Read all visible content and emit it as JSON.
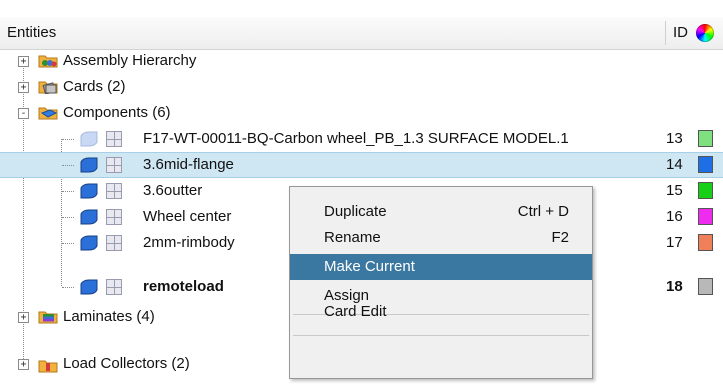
{
  "header": {
    "entities_label": "Entities",
    "id_label": "ID",
    "color_icon": "color-wheel-icon"
  },
  "tree": {
    "assembly": {
      "label": "Assembly Hierarchy",
      "expander": "+"
    },
    "cards": {
      "label": "Cards (2)",
      "expander": "+"
    },
    "components": {
      "label": "Components (6)",
      "expander": "-"
    },
    "laminates": {
      "label": "Laminates (4)",
      "expander": "+"
    },
    "load_collectors": {
      "label": "Load Collectors (2)",
      "expander": "+"
    }
  },
  "components": [
    {
      "label": "F17-WT-00011-BQ-Carbon wheel_PB_1.3 SURFACE MODEL.1",
      "id": "13",
      "color": "#7ee07e",
      "bold": false
    },
    {
      "label": "3.6mid-flange",
      "id": "14",
      "color": "#1e6fe6",
      "bold": false,
      "selected": true
    },
    {
      "label": "3.6outter",
      "id": "15",
      "color": "#16d016",
      "bold": false
    },
    {
      "label": "Wheel center",
      "id": "16",
      "color": "#ee2bee",
      "bold": false
    },
    {
      "label": "2mm-rimbody",
      "id": "17",
      "color": "#f0805a",
      "bold": false
    },
    {
      "label": "remoteload",
      "id": "18",
      "color": "#b8b8b8",
      "bold": true
    }
  ],
  "context_menu": {
    "duplicate": {
      "label": "Duplicate",
      "shortcut": "Ctrl + D"
    },
    "rename": {
      "label": "Rename",
      "shortcut": "F2"
    },
    "make_current": {
      "label": "Make Current"
    },
    "assign": {
      "label": "Assign"
    },
    "card_edit": {
      "label": "Card Edit"
    }
  },
  "colors": {
    "selection": "#cfe6f3",
    "menu_highlight": "#3b78a1"
  }
}
